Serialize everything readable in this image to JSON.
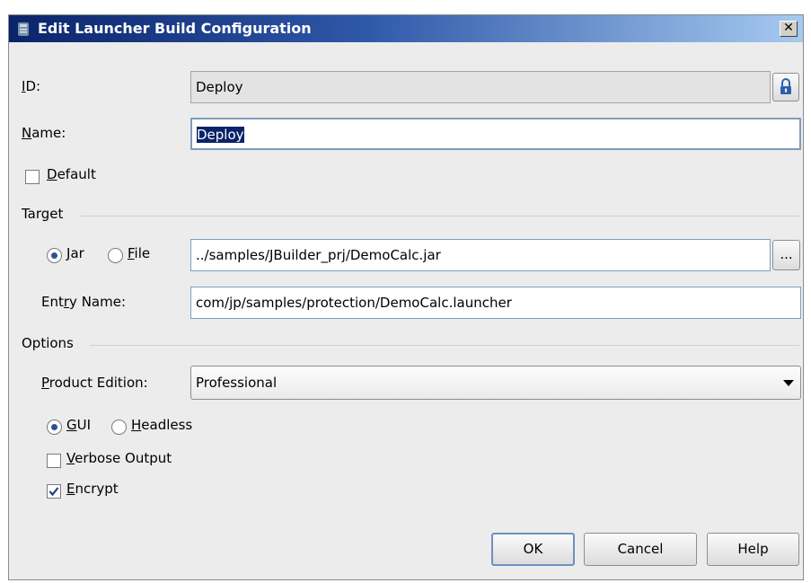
{
  "window": {
    "title": "Edit Launcher Build Configuration",
    "close_glyph": "✕"
  },
  "fields": {
    "id": {
      "label": "ID:",
      "mnemonic": "I",
      "rest": "D:",
      "value": "Deploy"
    },
    "name": {
      "label": "Name:",
      "mnemonic": "N",
      "rest": "ame:",
      "value": "Deploy"
    },
    "default": {
      "mnemonic": "D",
      "rest": "efault",
      "checked": false
    }
  },
  "target": {
    "section_label": "Target",
    "jar": {
      "mnemonic": "J",
      "rest": "ar",
      "selected": true
    },
    "file": {
      "mnemonic": "F",
      "rest": "ile",
      "selected": false
    },
    "path_value": "../samples/JBuilder_prj/DemoCalc.jar",
    "browse_label": "...",
    "entry_name": {
      "pre": "Ent",
      "mnemonic": "r",
      "rest": "y Name:",
      "value": "com/jp/samples/protection/DemoCalc.launcher"
    }
  },
  "options": {
    "section_label": "Options",
    "product_edition": {
      "mnemonic": "P",
      "rest": "roduct Edition:",
      "value": "Professional"
    },
    "gui": {
      "mnemonic": "G",
      "rest": "UI",
      "selected": true
    },
    "headless": {
      "mnemonic": "H",
      "rest": "eadless",
      "selected": false
    },
    "verbose": {
      "mnemonic": "V",
      "rest": "erbose Output",
      "checked": false
    },
    "encrypt": {
      "mnemonic": "E",
      "rest": "ncrypt",
      "checked": true
    }
  },
  "buttons": {
    "ok": "OK",
    "cancel": "Cancel",
    "help": "Help"
  },
  "icons": {
    "title": "launcher-icon",
    "lock": "lock-icon",
    "dropdown": "chevron-down-icon",
    "check": "checkmark-icon"
  },
  "colors": {
    "title_start": "#0a246a",
    "title_end": "#a6caf0",
    "selection": "#0a246a",
    "radio_dot": "#2b4f9c"
  }
}
